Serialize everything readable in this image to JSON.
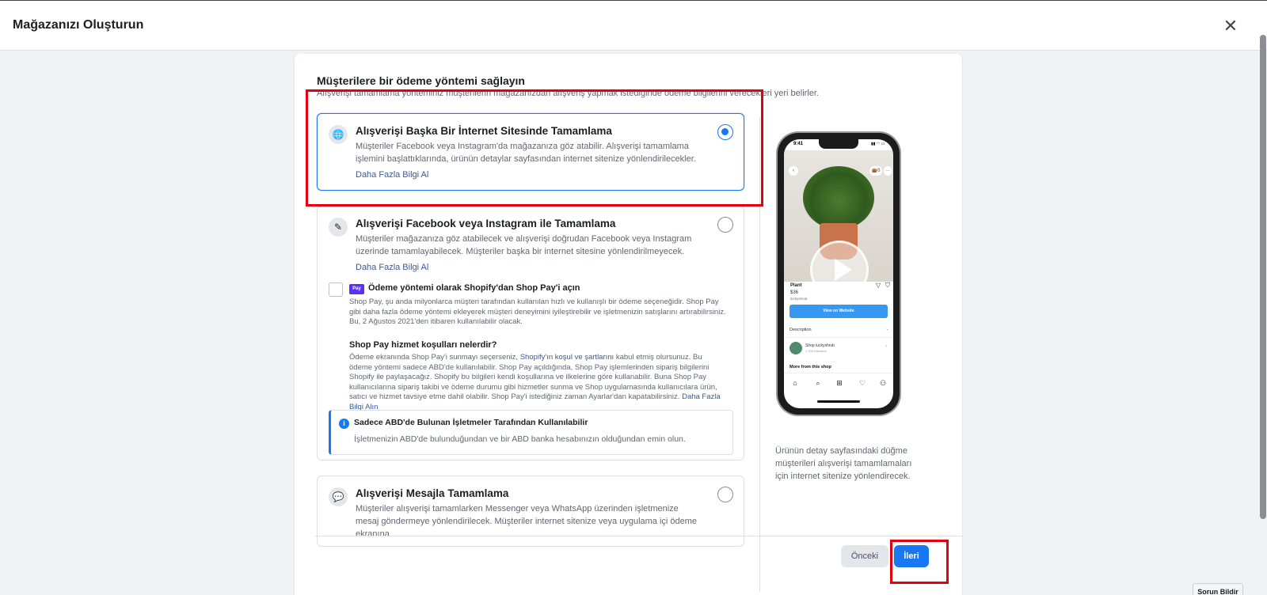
{
  "header": {
    "title": "Mağazanızı Oluşturun",
    "close_icon": "close-icon",
    "close_glyph": "✕"
  },
  "main": {
    "heading": "Müşterilere bir ödeme yöntemi sağlayın",
    "subheading": "Alışverişi tamamlama yönteminiz müşterilerin mağazanızdan alışveriş yapmak istediğinde ödeme bilgilerini vereceklerі yeri belirler.",
    "options": [
      {
        "icon": "globe-icon",
        "title": "Alışverişi Başka Bir İnternet Sitesinde Tamamlama",
        "description": "Müşteriler Facebook veya Instagram'da mağazanıza göz atabilir. Alışverişi tamamlama işlemini başlattıklarında, ürünün detaylar sayfasından internet sitenize yönlendirilecekler.",
        "link": "Daha Fazla Bilgi Al",
        "selected": true
      },
      {
        "icon": "tag-icon",
        "title": "Alışverişi Facebook veya Instagram ile Tamamlama",
        "description": "Müşteriler mağazanıza göz atabilecek ve alışverişi doğrudan Facebook veya Instagram üzerinde tamamlayabilecek. Müşteriler başka bir internet sitesine yönlendirilmeyecek.",
        "link": "Daha Fazla Bilgi Al",
        "selected": false
      },
      {
        "icon": "chat-icon",
        "title": "Alışverişi Mesajla Tamamlama",
        "description": "Müşteriler alışverişi tamamlarken Messenger veya WhatsApp üzerinden işletmenize mesaj göndermeye yönlendirilecek. Müşteriler internet sitenize veya uygulama içi ödeme ekranına",
        "selected": false
      }
    ],
    "shopify": {
      "badge": "Pay",
      "checkbox_label": "Ödeme yöntemi olarak Shopify'dan Shop Pay'i açın",
      "description": "Shop Pay, şu anda milyonlarca müşteri tarafından kullanılan hızlı ve kullanışlı bir ödeme seçeneğidir. Shop Pay gibi daha fazla ödeme yöntemi ekleyerek müşteri deneyimini iyileştirebilir ve işletmenizin satışlarını artırabilirsiniz. Bu, 2 Ağustos 2021'den itibaren kullanılabilir olacak.",
      "terms_question": "Shop Pay hizmet koşulları nelerdir?",
      "terms_text_1": "Ödeme ekranında Shop Pay'i sunmayı seçerseniz, ",
      "terms_link": "Shopify'ın koşul ve şartlarını",
      "terms_text_2": " kabul etmiş olursunuz. Bu ödeme yöntemi sadece ABD'de kullanılabilir. Shop Pay açıldığında, Shop Pay işlemlerinden sipariş bilgilerini Shopify ile paylaşacağız. Shopify bu bilgileri kendi koşullarına ve ilkelerine göre kullanabilir. Buna Shop Pay kullanıcılarına sipariş takibi ve ödeme durumu gibi hizmetler sunma ve Shop uygulamasında kullanıcılara ürün, satıcı ve hizmet tavsiye etme dahil olabilir. Shop Pay'i istediğiniz zaman Ayarlar'dan kapatabilirsiniz. ",
      "terms_more_link": "Daha Fazla Bilgi Alın"
    },
    "notice": {
      "icon": "info-icon",
      "glyph": "i",
      "title": "Sadece ABD'de Bulunan İşletmeler Tarafından Kullanılabilir",
      "description": "İşletmenizin ABD'de bulunduğundan ve bir ABD banka hesabınızın olduğundan emin olun."
    }
  },
  "preview": {
    "time": "9:41",
    "status": "▮▮ ◠ ▭",
    "back_glyph": "‹",
    "bag_glyph": "👜0",
    "more_glyph": "···",
    "product_name": "Plant",
    "product_price": "$36",
    "product_shop": "luckyshrub",
    "share_glyph": "▽",
    "save_glyph": "⛉",
    "view_button": "View on Website",
    "description_label": "Description",
    "chevron_down": "⌄",
    "shop_name": "Shop luckyshrub",
    "shop_followers": "1,209 followers",
    "chevron_right": "›",
    "more_from_shop": "More from this shop",
    "tabs": [
      "⌂",
      "⌕",
      "⊞",
      "♡",
      "⚇"
    ],
    "caption": "Ürünün detay sayfasındaki düğme müşterileri alışverişi tamamlamaları için internet sitenize yönlendirecek."
  },
  "footer": {
    "prev_label": "Önceki",
    "next_label": "İleri"
  },
  "report_button": "Sorun Bildir",
  "colors": {
    "accent": "#1877f2",
    "highlight": "#e3000f"
  }
}
